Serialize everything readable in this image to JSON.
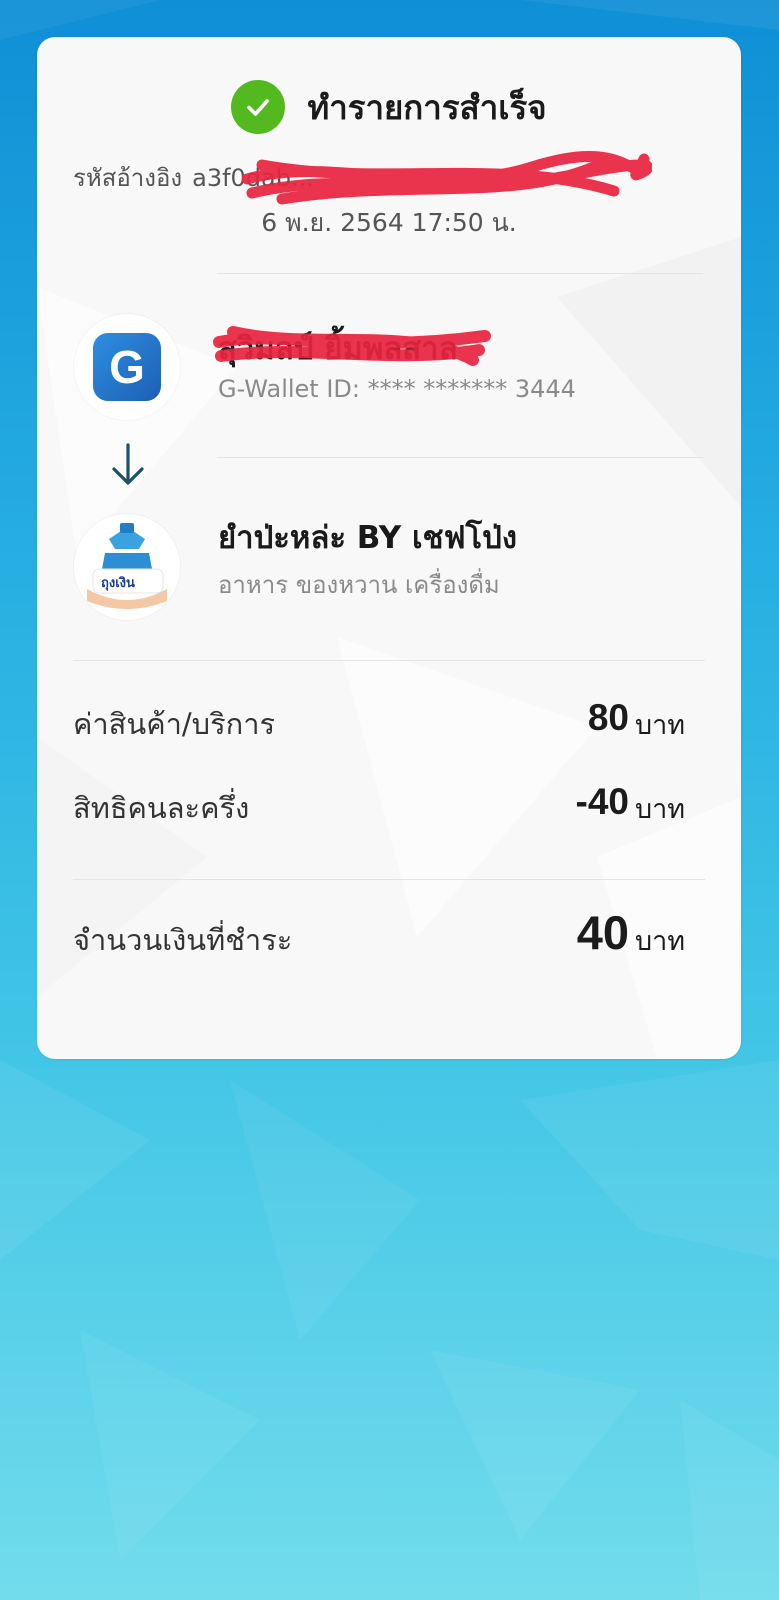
{
  "status": {
    "title": "ทำรายการสำเร็จ",
    "icon": "check-circle-icon",
    "color": "#52b91f"
  },
  "reference": {
    "label": "รหัสอ้างอิง",
    "value": "a3f0dab..."
  },
  "datetime": "6 พ.ย. 2564 17:50 น.",
  "sender": {
    "icon": "g-wallet-logo",
    "name": "สุวิมลป์ ยิ้มพลสาล",
    "wallet_id": "G-Wallet ID: **** ******* 3444"
  },
  "transfer_arrow_icon": "arrow-down-icon",
  "receiver": {
    "icon": "thung-ngoen-logo",
    "logo_text": "ถุงเงิน",
    "name": "ยำป่ะหล่ะ BY เชฟโป่ง",
    "category": "อาหาร ของหวาน เครื่องดื่ม"
  },
  "summary": {
    "items": [
      {
        "label": "ค่าสินค้า/บริการ",
        "amount": "80",
        "unit": "บาท"
      },
      {
        "label": "สิทธิคนละครึ่ง",
        "amount": "-40",
        "unit": "บาท"
      }
    ],
    "total": {
      "label": "จำนวนเงินที่ชำระ",
      "amount": "40",
      "unit": "บาท"
    }
  }
}
